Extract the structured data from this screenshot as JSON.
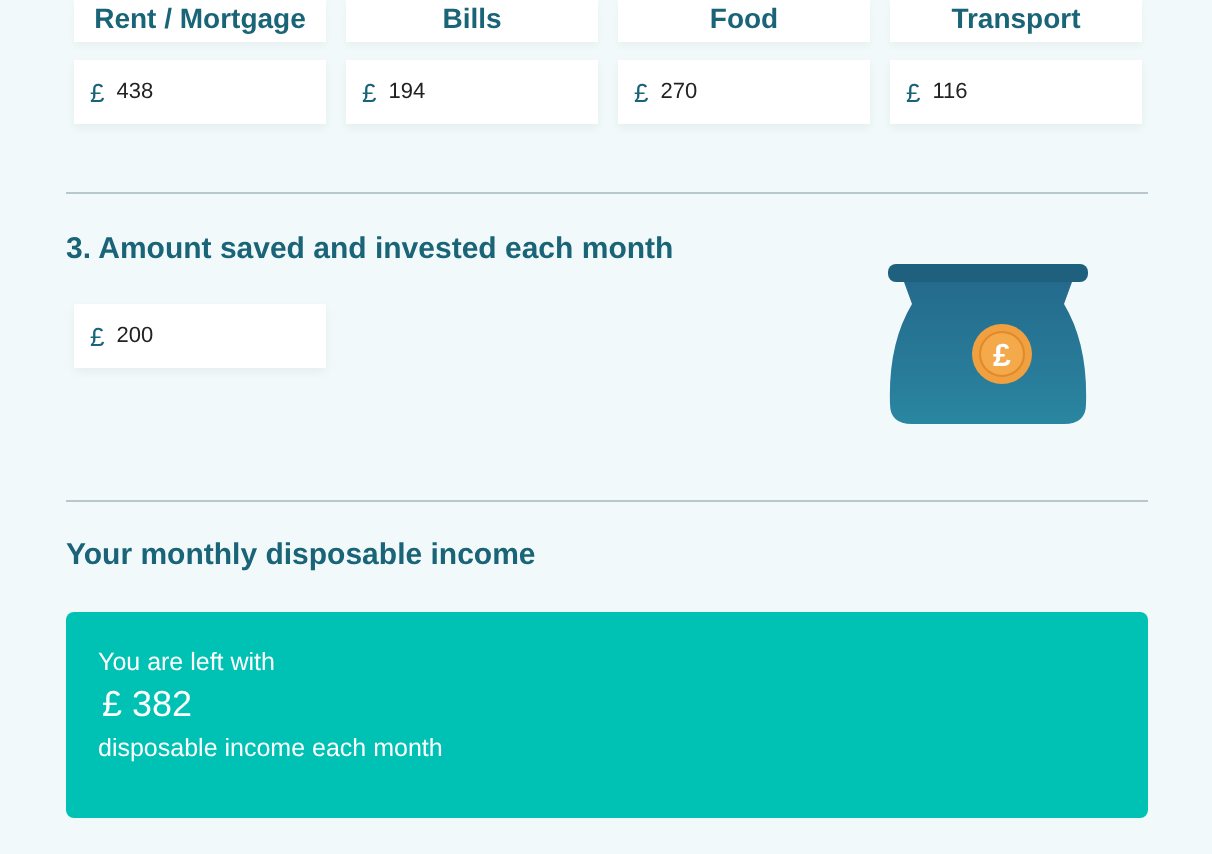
{
  "expenses": [
    {
      "label": "Rent / Mortgage",
      "currency": "£",
      "value": "438"
    },
    {
      "label": "Bills",
      "currency": "£",
      "value": "194"
    },
    {
      "label": "Food",
      "currency": "£",
      "value": "270"
    },
    {
      "label": "Transport",
      "currency": "£",
      "value": "116"
    }
  ],
  "savings": {
    "heading": "3. Amount saved and invested each month",
    "currency": "£",
    "value": "200",
    "icon_symbol": "£"
  },
  "result": {
    "heading": "Your monthly disposable income",
    "intro": "You are left with",
    "amount": "£ 382",
    "caption": "disposable income each month"
  }
}
